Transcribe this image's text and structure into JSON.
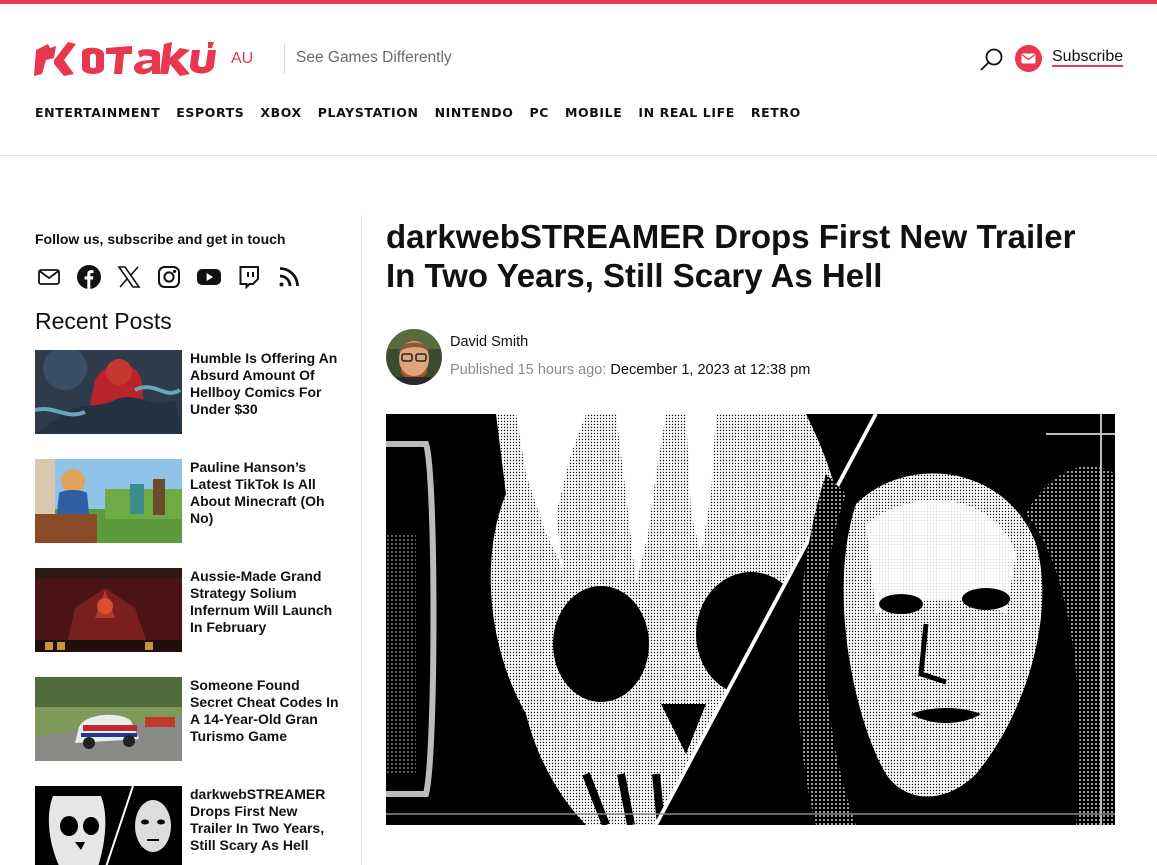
{
  "brand": {
    "region": "AU",
    "tagline": "See Games Differently",
    "accent": "#e8374f"
  },
  "header": {
    "subscribe_label": "Subscribe",
    "icons": [
      "search-icon",
      "mail-icon"
    ]
  },
  "nav": {
    "items": [
      "ENTERTAINMENT",
      "ESPORTS",
      "XBOX",
      "PLAYSTATION",
      "NINTENDO",
      "PC",
      "MOBILE",
      "IN REAL LIFE",
      "RETRO"
    ]
  },
  "sidebar": {
    "follow_text": "Follow us, subscribe and get in touch",
    "social_icons": [
      "mail-icon",
      "facebook-icon",
      "x-icon",
      "instagram-icon",
      "youtube-icon",
      "twitch-icon",
      "rss-icon"
    ],
    "recent_heading": "Recent Posts",
    "posts": [
      {
        "title": "Humble Is Offering An Absurd Amount Of Hellboy Comics For Under $30"
      },
      {
        "title": "Pauline Hanson’s Latest TikTok Is All About Minecraft (Oh No)"
      },
      {
        "title": "Aussie-Made Grand Strategy Solium Infernum Will Launch In February"
      },
      {
        "title": "Someone Found Secret Cheat Codes In A 14-Year-Old Gran Turismo Game"
      },
      {
        "title": "darkwebSTREAMER Drops First New Trailer In Two Years, Still Scary As Hell"
      }
    ]
  },
  "article": {
    "title": "darkwebSTREAMER Drops First New Trailer In Two Years, Still Scary As Hell",
    "author": "David Smith",
    "published_label": "Published 15 hours ago:",
    "published_date": "December 1, 2023 at 12:38 pm"
  }
}
